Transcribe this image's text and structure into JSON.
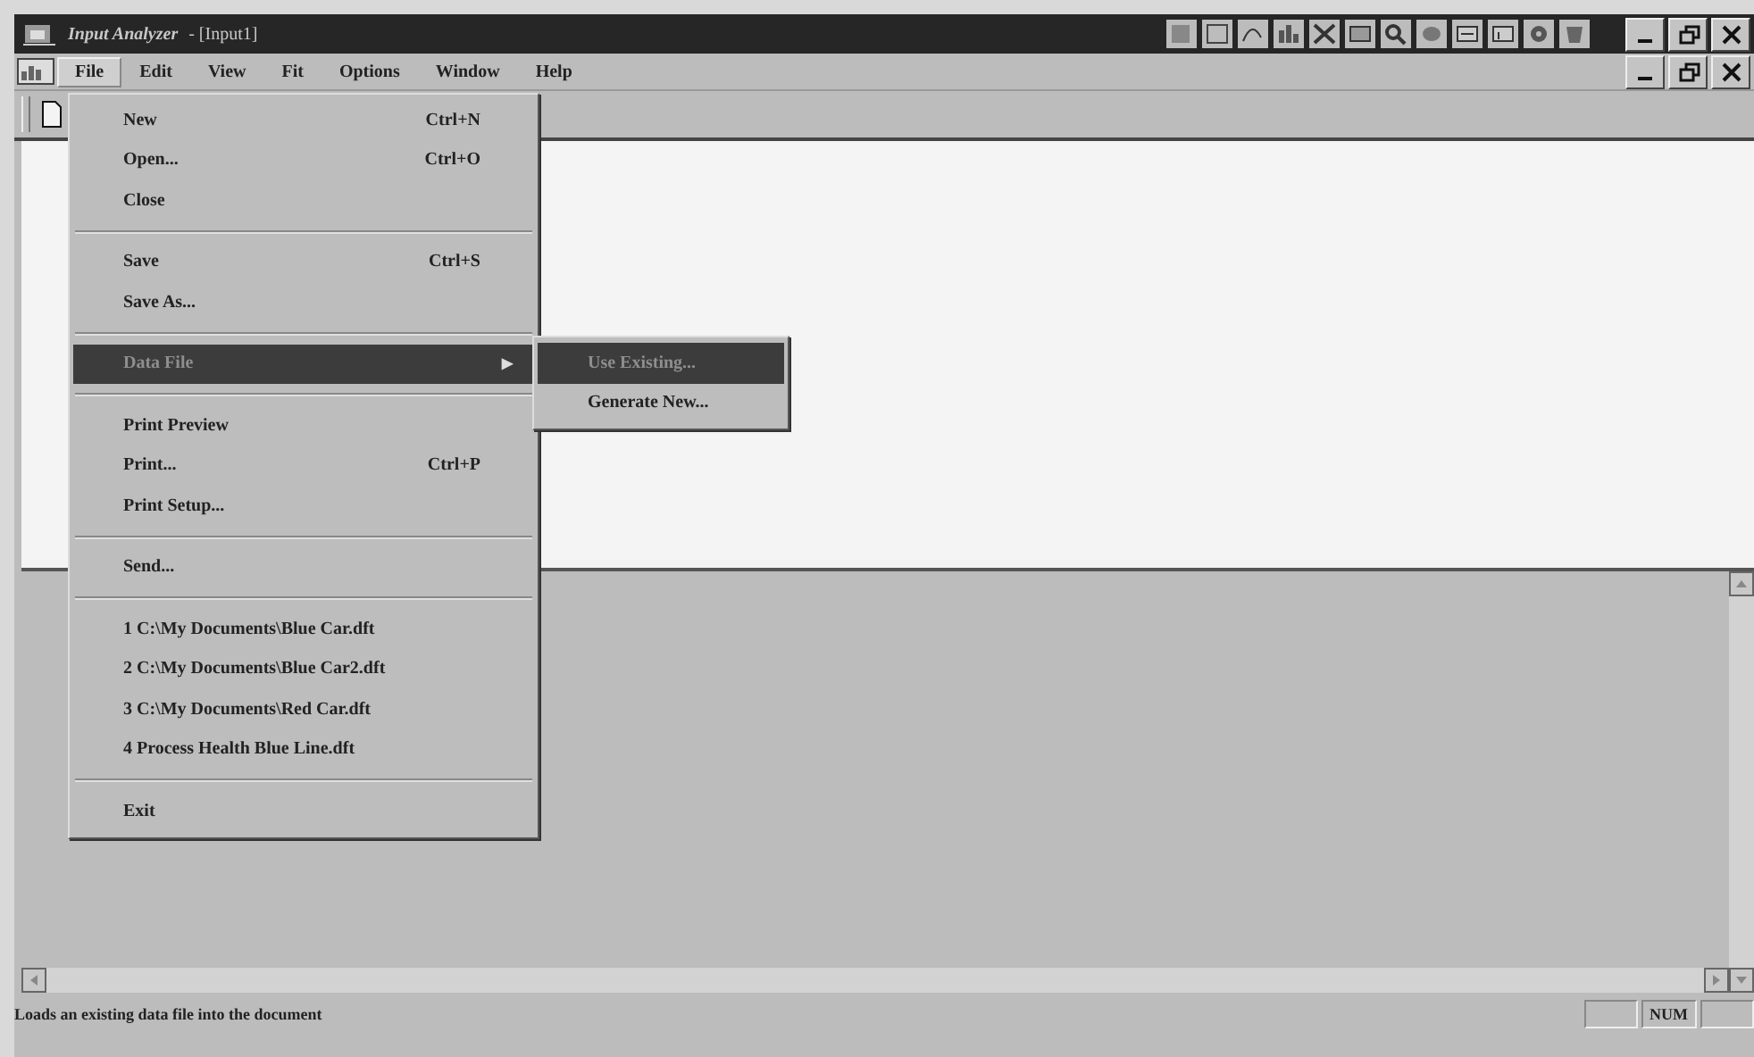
{
  "window": {
    "title": "Input Analyzer",
    "document": "- [Input1]"
  },
  "menu_bar": [
    {
      "label": "File",
      "selected": true
    },
    {
      "label": "Edit",
      "selected": false
    },
    {
      "label": "View",
      "selected": false
    },
    {
      "label": "Fit",
      "selected": false
    },
    {
      "label": "Options",
      "selected": false
    },
    {
      "label": "Window",
      "selected": false
    },
    {
      "label": "Help",
      "selected": false
    }
  ],
  "file_menu": [
    {
      "kind": "item",
      "label": "New",
      "shortcut": "Ctrl+N",
      "selected": false
    },
    {
      "kind": "item",
      "label": "Open...",
      "shortcut": "Ctrl+O",
      "selected": false
    },
    {
      "kind": "item",
      "label": "Close",
      "selected": false
    },
    {
      "kind": "separator"
    },
    {
      "kind": "item",
      "label": "Save",
      "shortcut": "Ctrl+S",
      "selected": false
    },
    {
      "kind": "item",
      "label": "Save As...",
      "selected": false
    },
    {
      "kind": "separator"
    },
    {
      "kind": "submenu",
      "label": "Data File",
      "arrow": "▶",
      "selected": true
    },
    {
      "kind": "separator"
    },
    {
      "kind": "item",
      "label": "Print Preview",
      "selected": false
    },
    {
      "kind": "item",
      "label": "Print...",
      "shortcut": "Ctrl+P",
      "selected": false
    },
    {
      "kind": "item",
      "label": "Print Setup...",
      "selected": false
    },
    {
      "kind": "separator"
    },
    {
      "kind": "item",
      "label": "Send...",
      "selected": false
    },
    {
      "kind": "separator"
    },
    {
      "kind": "item",
      "label": "1 C:\\My Documents\\Blue Car.dft",
      "selected": false
    },
    {
      "kind": "item",
      "label": "2 C:\\My Documents\\Blue Car2.dft",
      "selected": false
    },
    {
      "kind": "item",
      "label": "3 C:\\My Documents\\Red Car.dft",
      "selected": false
    },
    {
      "kind": "item",
      "label": "4 Process Health Blue Line.dft",
      "selected": false
    },
    {
      "kind": "separator"
    },
    {
      "kind": "item",
      "label": "Exit",
      "selected": false
    }
  ],
  "data_file_submenu": [
    {
      "kind": "item",
      "label": "Use Existing...",
      "selected": true
    },
    {
      "kind": "item",
      "label": "Generate New...",
      "selected": false
    }
  ],
  "status_bar": {
    "message": "Loads an existing data file into the document",
    "panels": [
      "NUM"
    ]
  }
}
